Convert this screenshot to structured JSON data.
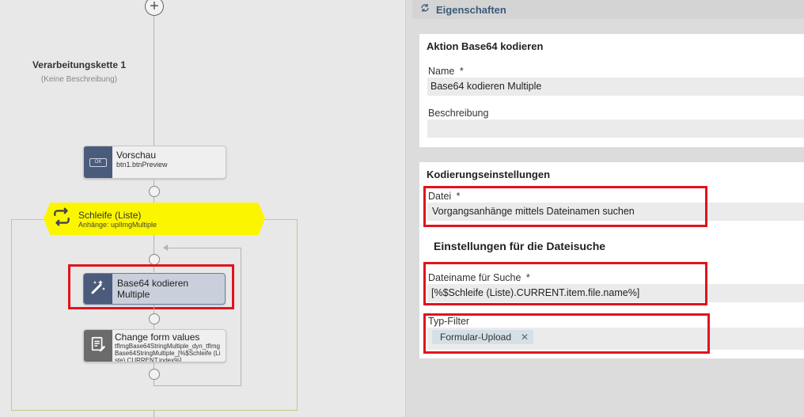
{
  "canvas": {
    "chain_title": "Verarbeitungskette 1",
    "chain_description": "(Keine Beschreibung)",
    "preview_node": {
      "title": "Vorschau",
      "subtitle": "btn1.btnPreview",
      "icon_label": "OK"
    },
    "loop_node": {
      "title": "Schleife (Liste)",
      "subtitle": "Anhänge: uplImgMultiple"
    },
    "base64_node": {
      "title_line1": "Base64 kodieren",
      "title_line2": "Multiple"
    },
    "change_node": {
      "title": "Change form values",
      "subtitle": "tfImgBase64StringMultiple_dyn_tfImgBase64StringMultiple_[%$Schleife (Liste).CURRENT.index%]"
    }
  },
  "properties": {
    "header_title": "Eigenschaften",
    "action_card": {
      "title": "Aktion Base64 kodieren",
      "name_label": "Name",
      "name_required": "*",
      "name_value": "Base64 kodieren Multiple",
      "description_label": "Beschreibung",
      "description_value": ""
    },
    "encoding_card": {
      "title": "Kodierungseinstellungen",
      "file_label": "Datei",
      "file_required": "*",
      "file_value": "Vorgangsanhänge mittels Dateinamen suchen",
      "search_heading": "Einstellungen für die Dateisuche",
      "filename_label": "Dateiname für Suche",
      "filename_required": "*",
      "filename_value": "[%$Schleife (Liste).CURRENT.item.file.name%]",
      "type_filter_label": "Typ-Filter",
      "type_filter_chip": "Formular-Upload"
    }
  },
  "colors": {
    "accent_header": "#3d5a7a",
    "highlight_red": "#e0141e",
    "loop_yellow": "#fbf600",
    "node_icon_dark": "#4b5b7c"
  }
}
